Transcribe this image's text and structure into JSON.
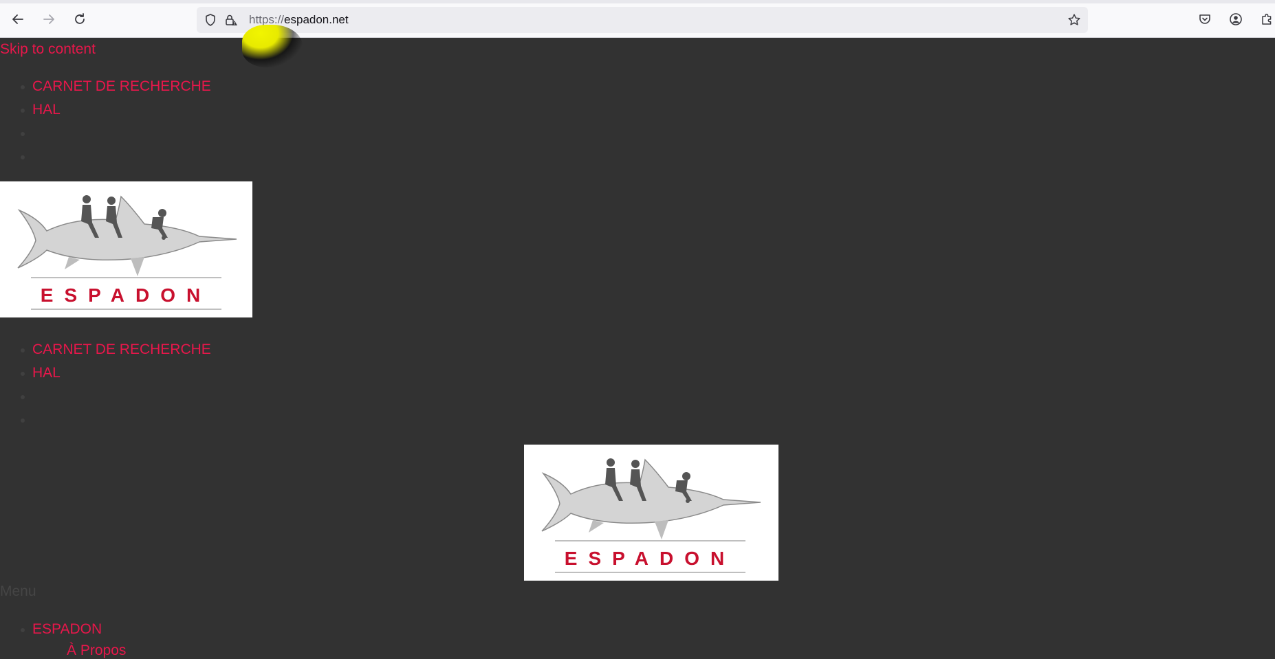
{
  "browser": {
    "url_scheme": "https://",
    "url_host": "espadon.net",
    "icons": [
      "back-arrow-icon",
      "forward-arrow-icon",
      "reload-icon",
      "shield-icon",
      "lock-warning-icon",
      "star-icon",
      "pocket-icon",
      "account-icon",
      "extensions-icon"
    ]
  },
  "page": {
    "skip_link": "Skip to content",
    "nav_top": [
      "CARNET DE RECHERCHE",
      "HAL",
      "",
      ""
    ],
    "nav_second": [
      "CARNET DE RECHERCHE",
      "HAL",
      "",
      ""
    ],
    "logo_text": "ESPADON",
    "menu_label": "Menu",
    "menu_item": "ESPADON",
    "menu_subitem": "À Propos"
  },
  "colors": {
    "page_bg": "#323232",
    "link": "#e8174b",
    "logo_red": "#c8102e"
  }
}
